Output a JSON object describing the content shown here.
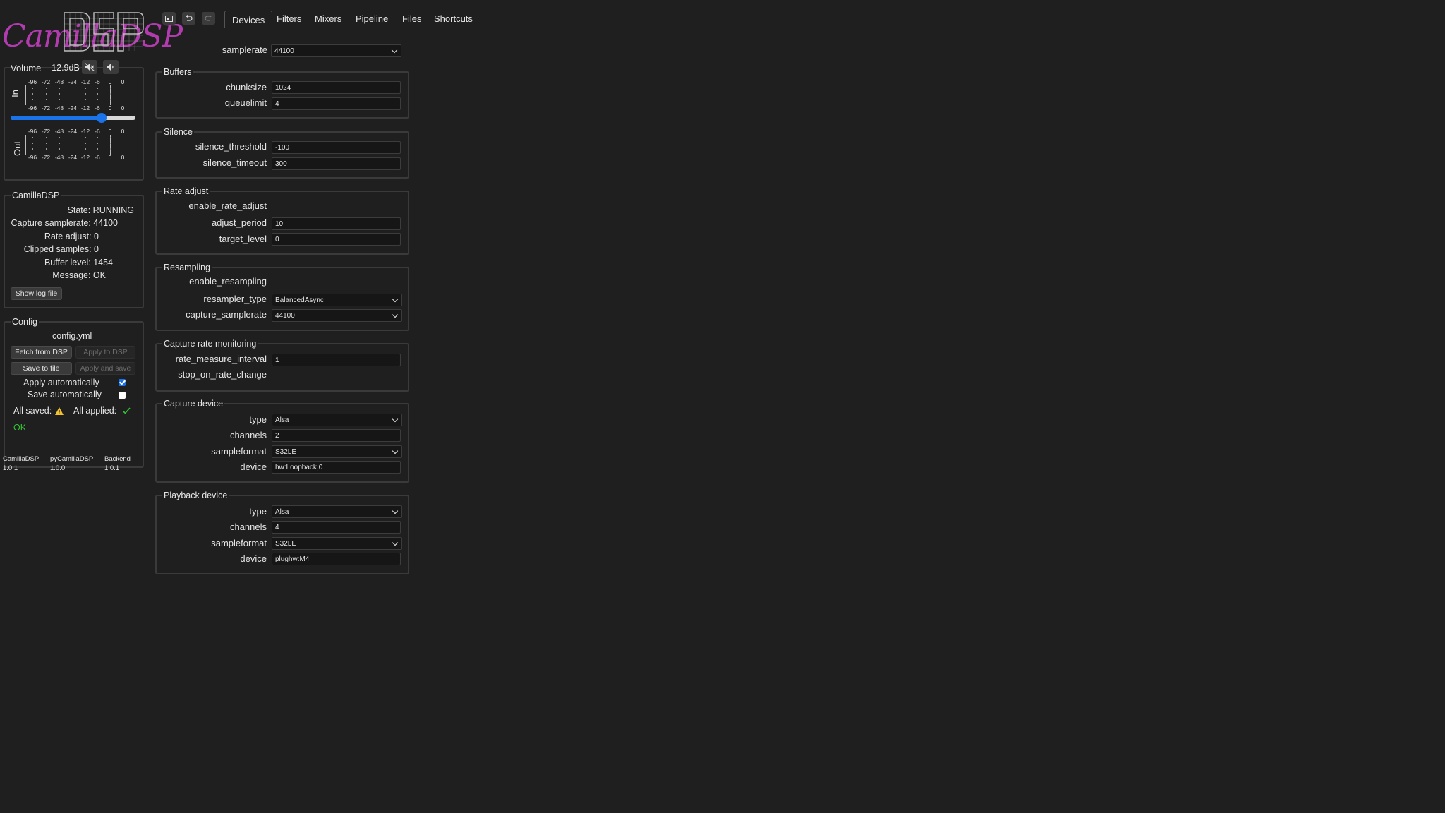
{
  "app": {
    "logo_text": "CamillaDSP"
  },
  "volume": {
    "title": "Volume",
    "value": "-12.9dB",
    "mute_icon": "speaker-muted-icon",
    "unmute_icon": "speaker-icon",
    "slider_fraction": 0.73,
    "in_label": "In",
    "out_label": "Out",
    "scale": [
      "-96",
      "-72",
      "-48",
      "-24",
      "-12",
      "-6",
      "0",
      "0"
    ]
  },
  "status": {
    "title": "CamillaDSP",
    "lines": [
      "State: RUNNING",
      "Capture samplerate: 44100",
      "Rate adjust: 0",
      "Clipped samples: 0",
      "Buffer level: 1454",
      "Message: OK"
    ],
    "show_log_button": "Show log file"
  },
  "config": {
    "title": "Config",
    "filename": "config.yml",
    "fetch_button": "Fetch from DSP",
    "apply_button": "Apply to DSP",
    "save_button": "Save to file",
    "apply_save_button": "Apply and save",
    "apply_auto_label": "Apply automatically",
    "apply_auto_checked": true,
    "save_auto_label": "Save automatically",
    "save_auto_checked": false,
    "all_saved_label": "All saved:",
    "all_applied_label": "All applied:",
    "ok_text": "OK",
    "warning_color": "#f2c12e",
    "ok_color": "#34c234"
  },
  "versions": [
    {
      "name": "CamillaDSP",
      "version": "1.0.1"
    },
    {
      "name": "pyCamillaDSP",
      "version": "1.0.0"
    },
    {
      "name": "Backend",
      "version": "1.0.1"
    }
  ],
  "toolbar": {
    "icons": [
      "screen-icon",
      "undo-icon",
      "redo-icon"
    ]
  },
  "tabs": [
    "Devices",
    "Filters",
    "Mixers",
    "Pipeline",
    "Files",
    "Shortcuts"
  ],
  "active_tab": "Devices",
  "devices": {
    "samplerate": {
      "label": "samplerate",
      "value": "44100"
    },
    "buffers": {
      "title": "Buffers",
      "chunksize": {
        "label": "chunksize",
        "value": "1024"
      },
      "queuelimit": {
        "label": "queuelimit",
        "value": "4"
      }
    },
    "silence": {
      "title": "Silence",
      "threshold": {
        "label": "silence_threshold",
        "value": "-100"
      },
      "timeout": {
        "label": "silence_timeout",
        "value": "300"
      }
    },
    "rate_adjust": {
      "title": "Rate adjust",
      "enable": {
        "label": "enable_rate_adjust",
        "checked": false
      },
      "adjust_period": {
        "label": "adjust_period",
        "value": "10"
      },
      "target_level": {
        "label": "target_level",
        "value": "0"
      }
    },
    "resampling": {
      "title": "Resampling",
      "enable": {
        "label": "enable_resampling",
        "checked": true
      },
      "resampler_type": {
        "label": "resampler_type",
        "value": "BalancedAsync"
      },
      "capture_samplerate": {
        "label": "capture_samplerate",
        "value": "44100"
      }
    },
    "rate_monitoring": {
      "title": "Capture rate monitoring",
      "interval": {
        "label": "rate_measure_interval",
        "value": "1"
      },
      "stop_on_change": {
        "label": "stop_on_rate_change",
        "checked": false
      }
    },
    "capture": {
      "title": "Capture device",
      "type": {
        "label": "type",
        "value": "Alsa"
      },
      "channels": {
        "label": "channels",
        "value": "2"
      },
      "sampleformat": {
        "label": "sampleformat",
        "value": "S32LE"
      },
      "device": {
        "label": "device",
        "value": "hw:Loopback,0"
      }
    },
    "playback": {
      "title": "Playback device",
      "type": {
        "label": "type",
        "value": "Alsa"
      },
      "channels": {
        "label": "channels",
        "value": "4"
      },
      "sampleformat": {
        "label": "sampleformat",
        "value": "S32LE"
      },
      "device": {
        "label": "device",
        "value": "plughw:M4"
      }
    }
  }
}
